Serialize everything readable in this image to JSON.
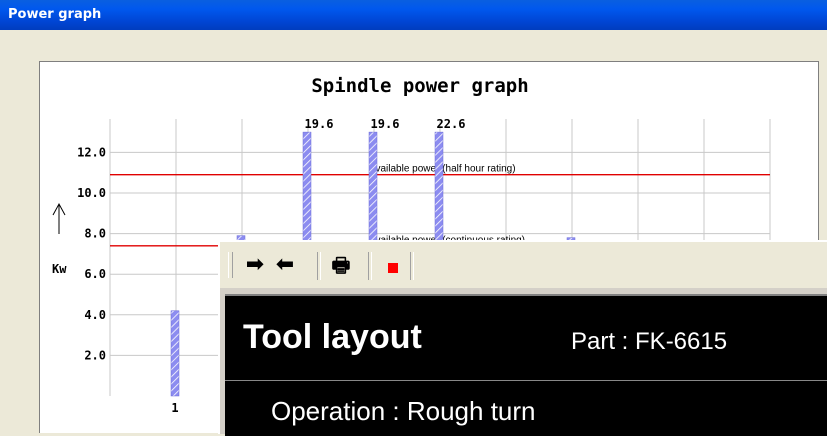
{
  "window": {
    "title": "Power graph"
  },
  "chart_data": {
    "type": "bar",
    "title": "Spindle power graph",
    "ylabel": "Kw",
    "ylim": [
      0,
      13
    ],
    "yticks": [
      "2.0",
      "4.0",
      "6.0",
      "8.0",
      "10.0",
      "12.0"
    ],
    "x_tick_labels": [
      {
        "index": 1,
        "label": "1"
      }
    ],
    "bars": [
      {
        "index": 1,
        "value": 4.2
      },
      {
        "index": 2,
        "value": 7.9
      },
      {
        "index": 3,
        "value": 19.6,
        "label": "19.6"
      },
      {
        "index": 4,
        "value": 19.6,
        "label": "19.6"
      },
      {
        "index": 5,
        "value": 22.6,
        "label": "22.6"
      },
      {
        "index": 7,
        "value": 7.8
      }
    ],
    "reference_lines": [
      {
        "value": 10.9,
        "label": "Available power (half hour rating)",
        "color": "#e00000"
      },
      {
        "value": 7.4,
        "label": "Available power (continuous rating)",
        "color": "#e00000"
      }
    ],
    "grid": true,
    "bar_color": "#8c8cf0"
  },
  "tool_window": {
    "toolbar": {
      "forward_icon": "right-arrow",
      "back_icon": "left-arrow",
      "print_icon": "printer",
      "stop_icon": "red-square-stop"
    },
    "title": "Tool layout",
    "part": "Part : FK-6615",
    "operation": "Operation : Rough  turn"
  }
}
